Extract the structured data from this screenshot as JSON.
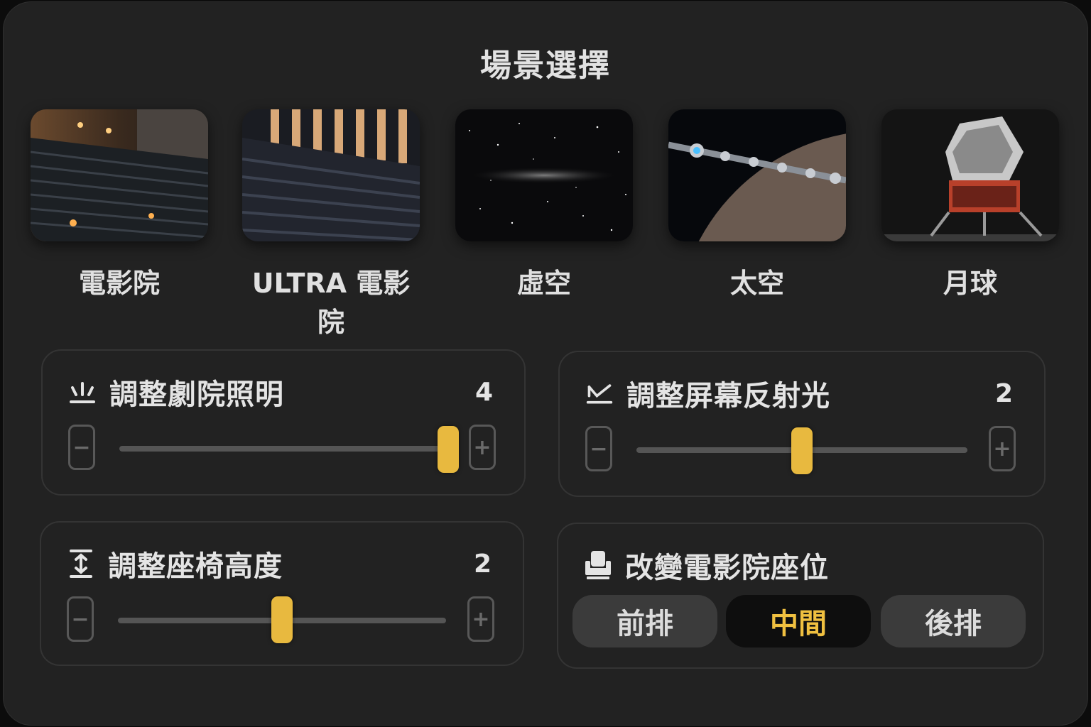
{
  "title": "場景選擇",
  "scenes": [
    {
      "label": "電影院",
      "image": "cinema-hall"
    },
    {
      "label": "ULTRA 電影院",
      "image": "ultra-cinema-hall"
    },
    {
      "label": "虛空",
      "image": "starfield-void"
    },
    {
      "label": "太空",
      "image": "spaceship-planet"
    },
    {
      "label": "月球",
      "image": "lunar-module"
    }
  ],
  "controls": {
    "lighting": {
      "label": "調整劇院照明",
      "value": "4",
      "icon": "lamp-rays-icon",
      "level": 1.0
    },
    "reflection": {
      "label": "調整屏幕反射光",
      "value": "2",
      "icon": "screen-reflection-icon",
      "level": 0.5
    },
    "seat_height": {
      "label": "調整座椅高度",
      "value": "2",
      "icon": "height-arrows-icon",
      "level": 0.5
    },
    "seat_position": {
      "label": "改變電影院座位",
      "icon": "seat-icon",
      "options": [
        "前排",
        "中間",
        "後排"
      ],
      "selected": "中間"
    }
  },
  "stepper": {
    "minus": "−",
    "plus": "+"
  },
  "colors": {
    "accent": "#e8b93f",
    "selected_text": "#f0c040",
    "panel": "#222222"
  }
}
